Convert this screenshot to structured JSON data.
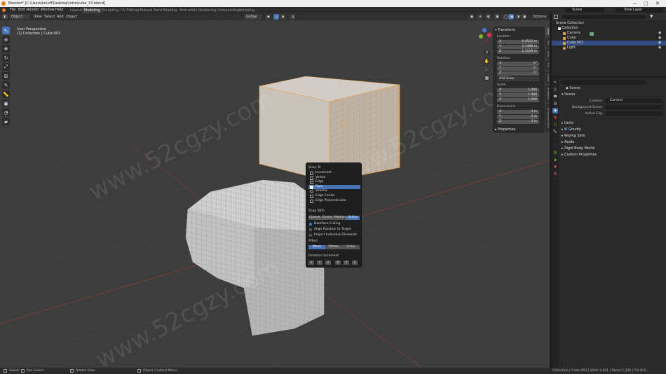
{
  "window": {
    "title": "Blender* [C:\\Users\\lenoff\\Desktop\\intro\\cube_13.blend]",
    "controls": [
      "—",
      "▢",
      "✕"
    ]
  },
  "menubar": {
    "menus": [
      "File",
      "Edit",
      "Render",
      "Window",
      "Help"
    ],
    "workspaces": [
      "Layout",
      "Modeling",
      "Sculpting",
      "UV Editing",
      "Texture Paint",
      "Shading",
      "Animation",
      "Rendering",
      "Compositing",
      "Scripting"
    ],
    "active_workspace": "Modeling",
    "scene": "Scene",
    "view_layer": "View Layer"
  },
  "vp_header": {
    "mode": "Object Mode",
    "menus": [
      "View",
      "Select",
      "Add",
      "Object"
    ],
    "transform_orientation": "Global",
    "options": "Options"
  },
  "viewport": {
    "view_name": "User Perspective",
    "collection_info": "(1) Collection | Cube.003",
    "watermark": "www.52cgzy.com"
  },
  "npanel": {
    "section": "Transform",
    "location_label": "Location",
    "location": [
      {
        "axis": "X",
        "value": "0.0512 m"
      },
      {
        "axis": "Y",
        "value": "1.1498 m"
      },
      {
        "axis": "Z",
        "value": "1.1119 m"
      }
    ],
    "rotation_label": "Rotation",
    "rotation": [
      {
        "axis": "X",
        "value": "0°"
      },
      {
        "axis": "Y",
        "value": "0°"
      },
      {
        "axis": "Z",
        "value": "0°"
      }
    ],
    "rotation_mode": "XYZ Euler",
    "scale_label": "Scale",
    "scale": [
      {
        "axis": "X",
        "value": "1.000"
      },
      {
        "axis": "Y",
        "value": "1.000"
      },
      {
        "axis": "Z",
        "value": "1.000"
      }
    ],
    "dimensions_label": "Dimensions",
    "dimensions": [
      {
        "axis": "X",
        "value": "2 m"
      },
      {
        "axis": "Y",
        "value": "2 m"
      },
      {
        "axis": "Z",
        "value": "2 m"
      }
    ],
    "properties_label": "Properties",
    "tabs": [
      "Item",
      "Tool",
      "View",
      "Edit",
      "Create",
      "Animation",
      "Screencast Keys"
    ]
  },
  "snap_popup": {
    "snap_to_label": "Snap To",
    "snap_to": [
      "Increment",
      "Vertex",
      "Edge",
      "Face",
      "Volume",
      "Edge Center",
      "Edge Perpendicular"
    ],
    "snap_to_selected": "Face",
    "snap_with_label": "Snap With",
    "snap_with": [
      "Closest",
      "Center",
      "Median",
      "Active"
    ],
    "snap_with_selected": "Active",
    "options": [
      {
        "label": "Backface Culling",
        "checked": true
      },
      {
        "label": "Align Rotation to Target",
        "checked": false
      },
      {
        "label": "Project Individual Elements",
        "checked": false
      }
    ],
    "affect_label": "Affect",
    "affect": [
      "Move",
      "Rotate",
      "Scale"
    ],
    "affect_selected": "Move",
    "rotation_increment_label": "Rotation Increment",
    "constraint_axes": [
      "X",
      "Y",
      "Z",
      "X",
      "Y",
      "Z"
    ]
  },
  "outliner": {
    "root": "Scene Collection",
    "items": [
      {
        "name": "Collection",
        "color": "#e8e8e8",
        "selected": false,
        "indent": 1
      },
      {
        "name": "Camera",
        "color": "#e8a24a",
        "selected": false,
        "indent": 2
      },
      {
        "name": "Cube",
        "color": "#e8a24a",
        "selected": false,
        "indent": 2
      },
      {
        "name": "Cube.003",
        "color": "#e8a24a",
        "selected": true,
        "indent": 2
      },
      {
        "name": "Light",
        "color": "#e8a24a",
        "selected": false,
        "indent": 2
      }
    ]
  },
  "properties": {
    "breadcrumb": "Scene",
    "section": "Scene",
    "fields": [
      {
        "label": "Camera",
        "value": "Camera"
      },
      {
        "label": "Background Scene",
        "value": ""
      },
      {
        "label": "Active Clip",
        "value": ""
      }
    ],
    "subsections": [
      "Units",
      "Gravity",
      "Keying Sets",
      "Audio",
      "Rigid Body World",
      "Custom Properties"
    ],
    "gravity_checked": true
  },
  "statusbar": {
    "select": "Select",
    "box_select": "Box Select",
    "rotate_view": "Rotate View",
    "context_menu": "Object Context Menu",
    "stats": "Collection | Cube.003 | Verts:3,421 | Faces:3,320 | Tris:6,6..."
  },
  "colors": {
    "accent": "#4772b3",
    "selection_outline": "#e8a24a",
    "viewport_bg": "#3d3d3d"
  }
}
